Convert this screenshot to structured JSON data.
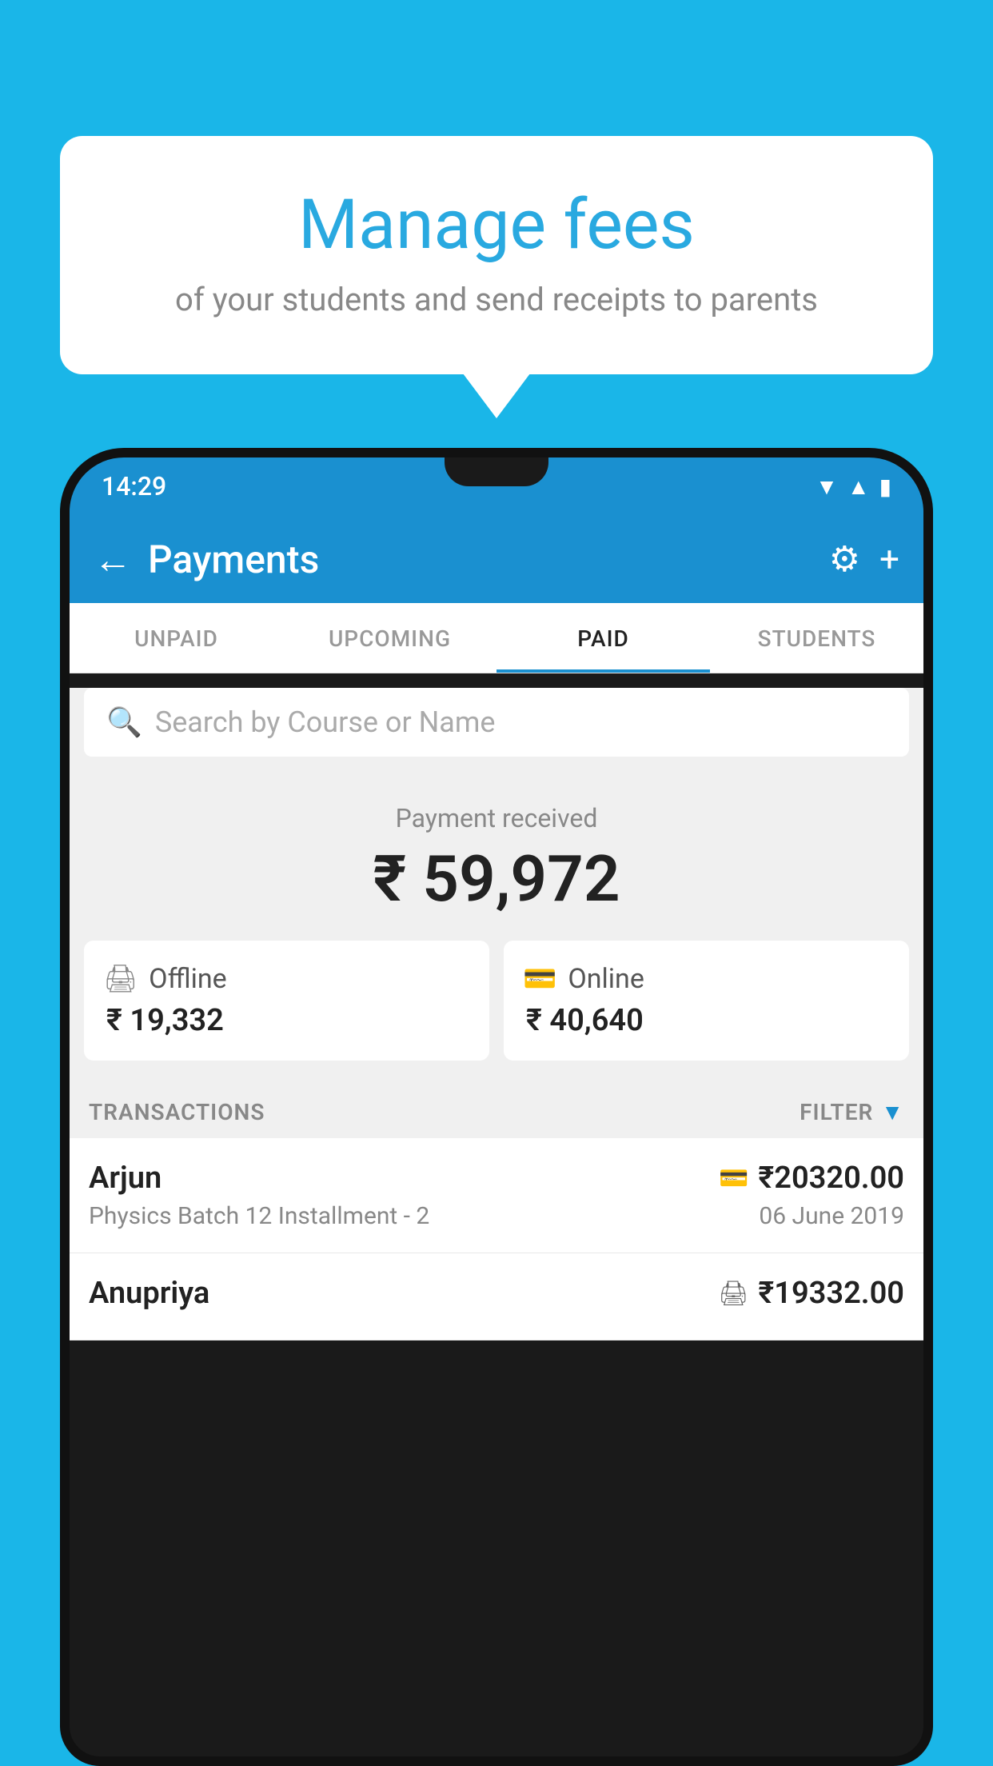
{
  "background_color": "#1ab6e8",
  "bubble": {
    "title": "Manage fees",
    "subtitle": "of your students and send receipts to parents"
  },
  "status_bar": {
    "time": "14:29",
    "icons": [
      "wifi",
      "signal",
      "battery"
    ]
  },
  "app_bar": {
    "title": "Payments",
    "back_icon": "←",
    "settings_icon": "⚙",
    "add_icon": "+"
  },
  "tabs": [
    {
      "label": "UNPAID",
      "active": false
    },
    {
      "label": "UPCOMING",
      "active": false
    },
    {
      "label": "PAID",
      "active": true
    },
    {
      "label": "STUDENTS",
      "active": false
    }
  ],
  "search": {
    "placeholder": "Search by Course or Name"
  },
  "payment": {
    "label": "Payment received",
    "amount": "₹ 59,972",
    "offline": {
      "label": "Offline",
      "amount": "₹ 19,332"
    },
    "online": {
      "label": "Online",
      "amount": "₹ 40,640"
    }
  },
  "transactions": {
    "header": "TRANSACTIONS",
    "filter": "FILTER",
    "rows": [
      {
        "name": "Arjun",
        "amount": "₹20320.00",
        "type": "online",
        "desc": "Physics Batch 12 Installment - 2",
        "date": "06 June 2019"
      },
      {
        "name": "Anupriya",
        "amount": "₹19332.00",
        "type": "offline",
        "desc": "",
        "date": ""
      }
    ]
  }
}
